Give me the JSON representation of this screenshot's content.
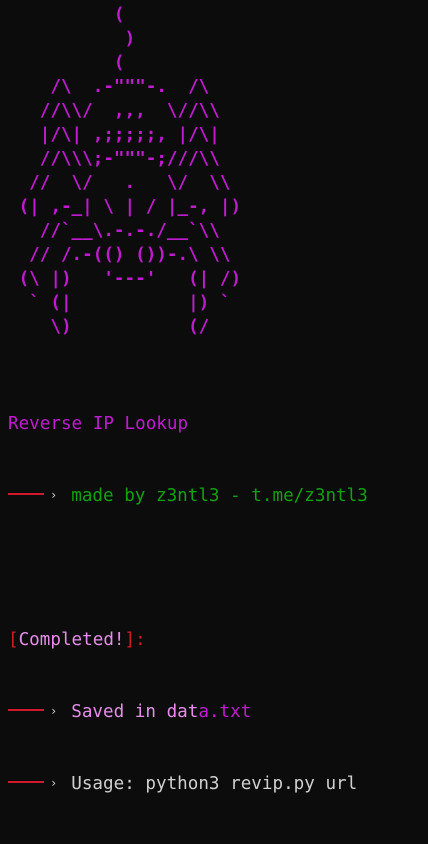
{
  "ascii_art": {
    "lines": [
      "          (",
      "           )",
      "          (",
      "    /\\  .-\"\"\"-.  /\\",
      "   //\\\\/  ,,,  \\//\\\\",
      "   |/\\| ,;;;;;, |/\\|",
      "   //\\\\\\;-\"\"\"-;///\\\\",
      "  //  \\/   .   \\/  \\\\",
      " (| ,-_| \\ | / |_-, |)",
      "   //`__\\.-.-./__`\\\\",
      "  // /.-(() ())-.\\ \\\\",
      " (\\ |)   '---'   (| /)",
      "  ` (|           |) `",
      "    \\)           (/"
    ]
  },
  "title": "Reverse IP Lookup",
  "credit": "made by z3ntl3 - t.me/z3ntl3",
  "status": {
    "open_bracket": "[",
    "label": "Completed!",
    "close_bracket": "]:"
  },
  "saved": {
    "prefix": "Saved in dat",
    "suffix": "a.txt"
  },
  "usage": "Usage: python3 revip.py url",
  "colors": {
    "magenta": "#c01bd0",
    "pink": "#e58ee9",
    "green": "#13a10e",
    "red": "#d21a2d",
    "background": "#0c0c0c"
  },
  "icons": {
    "arrow": "arrow-icon"
  }
}
